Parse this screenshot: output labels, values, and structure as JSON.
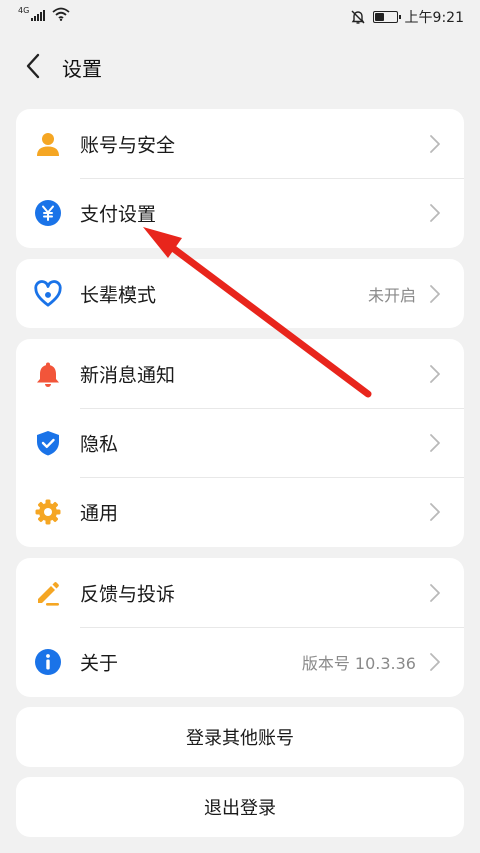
{
  "status_bar": {
    "network": "4G",
    "time": "上午9:21",
    "battery_level": 0.45
  },
  "header": {
    "title": "设置"
  },
  "sections": [
    {
      "items": [
        {
          "label": "账号与安全",
          "value": "",
          "icon": "person-icon"
        },
        {
          "label": "支付设置",
          "value": "",
          "icon": "yuan-icon"
        }
      ]
    },
    {
      "items": [
        {
          "label": "长辈模式",
          "value": "未开启",
          "icon": "heart-icon"
        }
      ]
    },
    {
      "items": [
        {
          "label": "新消息通知",
          "value": "",
          "icon": "bell-icon"
        },
        {
          "label": "隐私",
          "value": "",
          "icon": "shield-icon"
        },
        {
          "label": "通用",
          "value": "",
          "icon": "gear-icon"
        }
      ]
    },
    {
      "items": [
        {
          "label": "反馈与投诉",
          "value": "",
          "icon": "pencil-icon"
        },
        {
          "label": "关于",
          "value": "版本号 10.3.36",
          "icon": "info-icon"
        }
      ]
    }
  ],
  "actions": {
    "switch_account": "登录其他账号",
    "logout": "退出登录"
  },
  "colors": {
    "background": "#f1f1f1",
    "card": "#ffffff",
    "orange": "#f5a623",
    "blue": "#1a73e8",
    "red_bell": "#f2553a",
    "annotation_arrow": "#e8251c"
  }
}
